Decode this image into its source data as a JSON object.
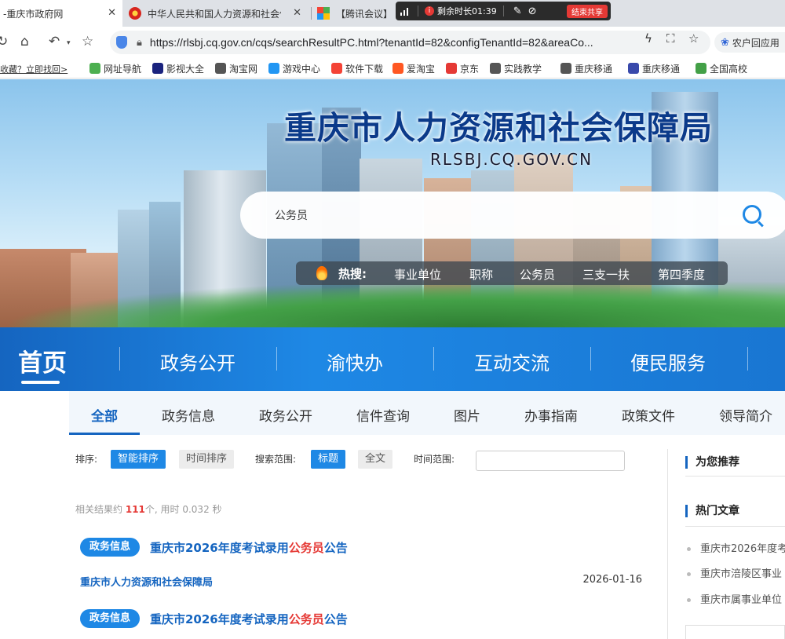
{
  "browser": {
    "tabs": [
      {
        "title": "-重庆市政府网",
        "close": "✕"
      },
      {
        "title": "中华人民共和国人力资源和社会保障部",
        "close": "✕"
      },
      {
        "title": "【腾讯会议】"
      }
    ],
    "meeting": {
      "remaining": "剩余时长01:39",
      "end_label": "结束共享"
    },
    "url": "https://rlsbj.cq.gov.cn/cqs/searchResultPC.html?tenantId=82&configTenantId=82&areaCo...",
    "extension_label": "农户回应用"
  },
  "bookmarks": {
    "notice": "收藏？立即找回>",
    "items": [
      {
        "label": "网址导航",
        "color": "#4caf50"
      },
      {
        "label": "影视大全",
        "color": "#1a237e"
      },
      {
        "label": "淘宝网",
        "color": "#555555"
      },
      {
        "label": "游戏中心",
        "color": "#2196f3"
      },
      {
        "label": "软件下载",
        "color": "#f44336"
      },
      {
        "label": "爱淘宝",
        "color": "#ff5722"
      },
      {
        "label": "京东",
        "color": "#e53935"
      },
      {
        "label": "实践教学",
        "color": "#555555"
      },
      {
        "label": "重庆移通",
        "color": "#555555"
      },
      {
        "label": "重庆移通",
        "color": "#3949ab"
      },
      {
        "label": "全国高校",
        "color": "#43a047"
      }
    ]
  },
  "hero": {
    "title": "重庆市人力资源和社会保障局",
    "subtitle": "RLSBJ.CQ.GOV.CN",
    "search_value": "公务员",
    "hot_label": "热搜:",
    "hot_items": [
      "事业单位",
      "职称",
      "公务员",
      "三支一扶",
      "第四季度"
    ]
  },
  "main_nav": [
    "首页",
    "政务公开",
    "渝快办",
    "互动交流",
    "便民服务"
  ],
  "sub_tabs": [
    "全部",
    "政务信息",
    "政务公开",
    "信件查询",
    "图片",
    "办事指南",
    "政策文件",
    "领导简介"
  ],
  "filters": {
    "sort_label": "排序:",
    "sort_smart": "智能排序",
    "sort_time": "时间排序",
    "scope_label": "搜索范围:",
    "scope_title": "标题",
    "scope_full": "全文",
    "time_label": "时间范围:"
  },
  "stats": {
    "prefix": "相关结果约",
    "count": "111",
    "suffix": "个,  用时 0.032 秒"
  },
  "results": [
    {
      "badge": "政务信息",
      "title_pre": "重庆市2026年度考试录用",
      "title_hl": "公务员",
      "title_post": "公告",
      "source": "重庆市人力资源和社会保障局",
      "date": "2026-01-16"
    },
    {
      "badge": "政务信息",
      "title_pre": "重庆市2026年度考试录用",
      "title_hl": "公务员",
      "title_post": "公告"
    }
  ],
  "sidebar": {
    "recommend_heading": "为您推荐",
    "hot_heading": "热门文章",
    "hot_items": [
      "重庆市2026年度考",
      "重庆市涪陵区事业",
      "重庆市属事业单位"
    ]
  }
}
